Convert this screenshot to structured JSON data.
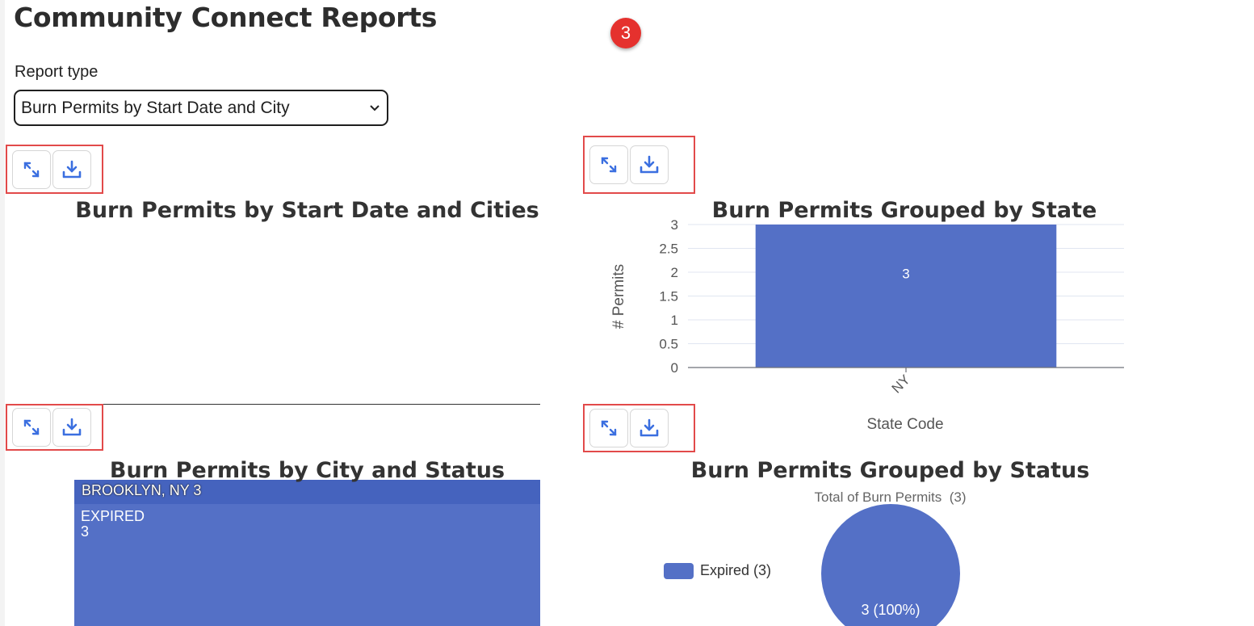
{
  "page": {
    "title": "Community Connect Reports",
    "badge": "3"
  },
  "report_type": {
    "label": "Report type",
    "selected": "Burn Permits by Start Date and City"
  },
  "colors": {
    "accent": "#5470c6",
    "highlight": "#e24a4a",
    "badge": "#e5312e",
    "icon": "#3b6fe0"
  },
  "charts": {
    "start_date": {
      "title": "Burn Permits by Start Date and Cities"
    },
    "state": {
      "title": "Burn Permits Grouped by State",
      "ylabel": "# Permits",
      "xlabel": "State Code",
      "category": "NY",
      "bar_label": "3"
    },
    "city_status": {
      "title": "Burn Permits by City and Status",
      "header": "BROOKLYN, NY 3",
      "node_label": "EXPIRED",
      "node_value": "3"
    },
    "status": {
      "title": "Burn Permits Grouped by Status",
      "subtitle": "Total of Burn Permits  (3)",
      "legend": "Expired (3)",
      "slice_label": "3 (100%)"
    }
  },
  "chart_data": [
    {
      "type": "bar",
      "title": "Burn Permits Grouped by State",
      "xlabel": "State Code",
      "ylabel": "# Permits",
      "categories": [
        "NY"
      ],
      "values": [
        3
      ],
      "ylim": [
        0,
        3
      ],
      "yticks": [
        "0",
        "0.5",
        "1",
        "1.5",
        "2",
        "2.5",
        "3"
      ],
      "grid": true
    },
    {
      "type": "pie",
      "title": "Burn Permits Grouped by Status",
      "subtitle": "Total of Burn Permits  (3)",
      "labels": [
        "Expired"
      ],
      "values": [
        3
      ],
      "legend": "left"
    }
  ]
}
